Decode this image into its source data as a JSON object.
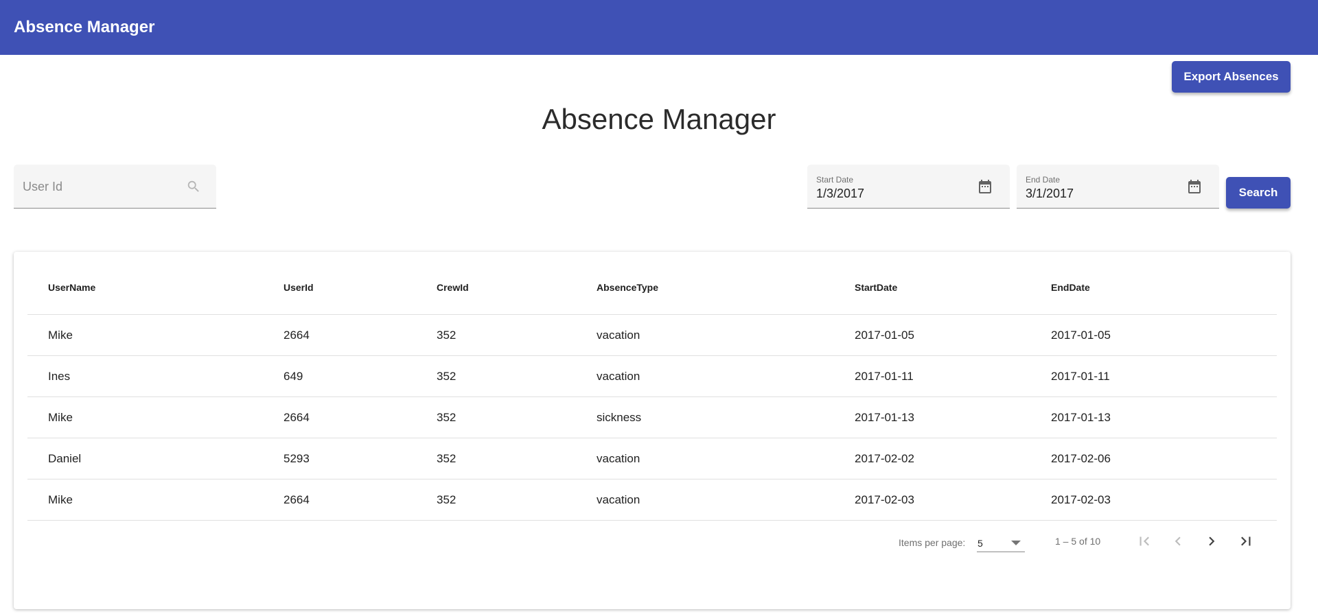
{
  "app": {
    "title": "Absence Manager"
  },
  "actions": {
    "export_label": "Export Absences",
    "search_label": "Search"
  },
  "page": {
    "title": "Absence Manager"
  },
  "filters": {
    "user_id_placeholder": "User Id",
    "start_date": {
      "label": "Start Date",
      "value": "1/3/2017"
    },
    "end_date": {
      "label": "End Date",
      "value": "3/1/2017"
    }
  },
  "table": {
    "columns": [
      "UserName",
      "UserId",
      "CrewId",
      "AbsenceType",
      "StartDate",
      "EndDate"
    ],
    "rows": [
      [
        "Mike",
        "2664",
        "352",
        "vacation",
        "2017-01-05",
        "2017-01-05"
      ],
      [
        "Ines",
        "649",
        "352",
        "vacation",
        "2017-01-11",
        "2017-01-11"
      ],
      [
        "Mike",
        "2664",
        "352",
        "sickness",
        "2017-01-13",
        "2017-01-13"
      ],
      [
        "Daniel",
        "5293",
        "352",
        "vacation",
        "2017-02-02",
        "2017-02-06"
      ],
      [
        "Mike",
        "2664",
        "352",
        "vacation",
        "2017-02-03",
        "2017-02-03"
      ]
    ]
  },
  "paginator": {
    "items_per_page_label": "Items per page:",
    "items_per_page_value": "5",
    "range_label": "1 – 5 of 10"
  },
  "icons": {
    "search": "search-icon",
    "calendar": "calendar-icon",
    "first_page": "first-page-icon",
    "prev_page": "chevron-left-icon",
    "next_page": "chevron-right-icon",
    "last_page": "last-page-icon",
    "dropdown": "dropdown-arrow-icon"
  },
  "colors": {
    "primary": "#3f51b5",
    "field_background": "#f5f5f5",
    "row_divider": "#e0e0e0"
  }
}
